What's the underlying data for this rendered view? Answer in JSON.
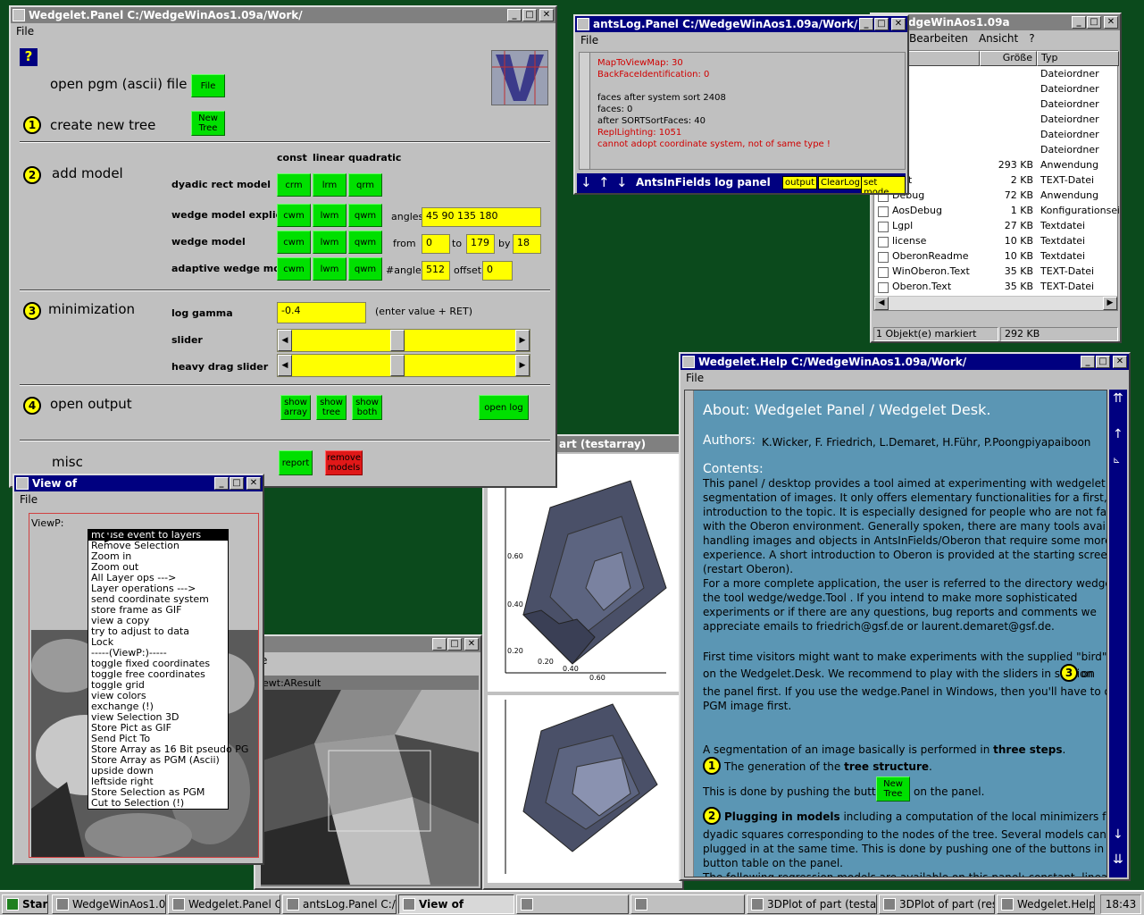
{
  "panel": {
    "title": "Wedgelet.Panel C:/WedgeWinAos1.09a/Work/",
    "menu_file": "File",
    "help_glyph": "?",
    "open_pgm": "open pgm (ascii) file",
    "file_btn": "File",
    "sec1": "create new tree",
    "new_tree_btn": "New\nTree",
    "sec2": "add model",
    "col_const": "const",
    "col_linear": "linear",
    "col_quadratic": "quadratic",
    "row_dyadic": "dyadic rect model",
    "btn_crm": "crm",
    "btn_lrm": "lrm",
    "btn_qrm": "qrm",
    "row_wedge_explicit": "wedge model explicit",
    "row_wedge": "wedge model",
    "row_adaptive": "adaptive wedge model",
    "btn_cwm": "cwm",
    "btn_lwm": "lwm",
    "btn_qwm": "qwm",
    "angles_label": "angles",
    "angles_value": "45 90 135 180",
    "from_label": "from",
    "from_value": "0",
    "to_label": "to",
    "to_value": "179",
    "by_label": "by",
    "by_value": "18",
    "nangles_label": "#angles",
    "nangles_value": "512",
    "offset_label": "offset",
    "offset_value": "0",
    "sec3": "minimization",
    "log_gamma_label": "log gamma",
    "log_gamma_value": "-0.4",
    "enter_hint": "(enter value + RET)",
    "slider_label": "slider",
    "heavy_slider_label": "heavy drag slider",
    "sec4": "open output",
    "show_array": "show\narray",
    "show_tree": "show\ntree",
    "show_both": "show\nboth",
    "open_log": "open log",
    "misc": "misc",
    "report": "report",
    "remove_models": "remove\nmodels",
    "n1": "1",
    "n2": "2",
    "n3": "3",
    "n4": "4"
  },
  "log": {
    "title": "antsLog.Panel C:/WedgeWinAos1.09a/Work/ants...",
    "menu_file": "File",
    "lines": [
      {
        "text": "MapToViewMap:   30",
        "red": true
      },
      {
        "text": "BackFaceIdentification:   0",
        "red": true
      },
      {
        "text": "",
        "red": false
      },
      {
        "text": "faces after system sort       2408",
        "red": false
      },
      {
        "text": "faces:              0",
        "red": false
      },
      {
        "text": "after SORTSortFaces:   40",
        "red": false
      },
      {
        "text": "ReplLighting:     1051",
        "red": true
      },
      {
        "text": "cannot adopt coordinate system, not of same type !",
        "red": true
      }
    ],
    "footer_title": "AntsInFields log panel",
    "btn_output": "output",
    "btn_clearlog": "ClearLog",
    "btn_setmode": "set mode"
  },
  "explorer": {
    "title": "WedgeWinAos1.09a",
    "menu": [
      "Bearbeiten",
      "Ansicht",
      "?"
    ],
    "col_size": "Größe",
    "col_type": "Typ",
    "rows": [
      {
        "name": "",
        "size": "",
        "type": "Dateiordner"
      },
      {
        "name": "et",
        "size": "",
        "type": "Dateiordner"
      },
      {
        "name": "u",
        "size": "",
        "type": "Dateiordner"
      },
      {
        "name": "",
        "size": "",
        "type": "Dateiordner"
      },
      {
        "name": "em",
        "size": "",
        "type": "Dateiordner"
      },
      {
        "name": "",
        "size": "",
        "type": "Dateiordner"
      },
      {
        "name": "",
        "size": "293 KB",
        "type": "Anwendung"
      },
      {
        "name": "Text",
        "size": "2 KB",
        "type": "TEXT-Datei"
      },
      {
        "name": "Debug",
        "size": "72 KB",
        "type": "Anwendung"
      },
      {
        "name": "AosDebug",
        "size": "1 KB",
        "type": "Konfigurationseinst"
      },
      {
        "name": "Lgpl",
        "size": "27 KB",
        "type": "Textdatei"
      },
      {
        "name": "license",
        "size": "10 KB",
        "type": "Textdatei"
      },
      {
        "name": "OberonReadme",
        "size": "10 KB",
        "type": "Textdatei"
      },
      {
        "name": "WinOberon.Text",
        "size": "35 KB",
        "type": "TEXT-Datei"
      },
      {
        "name": "Oberon.Text",
        "size": "35 KB",
        "type": "TEXT-Datei"
      }
    ],
    "status_left": "1 Objekt(e) markiert",
    "status_right": "292 KB"
  },
  "viewof": {
    "title": "View of",
    "menu_file": "File",
    "viewp": "ViewP:",
    "menu_items": [
      "mouse event to layers",
      "Remove Selection",
      "Zoom in",
      "Zoom out",
      "All Layer ops --->",
      "Layer operations --->",
      "send coordinate system",
      "store frame as GIF",
      "view a copy",
      "try to adjust to data",
      "Lock",
      "-----(ViewP:)-----",
      "toggle fixed coordinates",
      "toggle free coordinates",
      "toggle grid",
      "view colors",
      "exchange (!)",
      "view Selection 3D",
      "Store Pict as GIF",
      "Send Pict To",
      "Store Array as 16 Bit pseudo PG",
      "Store Array as PGM (Ascii)",
      "upside down",
      "leftside right",
      "Store Selection as PGM",
      "Cut to Selection (!)"
    ]
  },
  "result": {
    "frag_e": "e",
    "label": "ewt:AResult"
  },
  "plot": {
    "title": "art (testarray)",
    "ticks_y": [
      "0.60",
      "0.40",
      "0.20"
    ],
    "ticks_x": [
      "0.20",
      "0.40",
      "0.60",
      "0.80"
    ]
  },
  "help": {
    "title": "Wedgelet.Help C:/WedgeWinAos1.09a/Work/",
    "menu_file": "File",
    "about": "About: Wedgelet Panel / Wedgelet Desk.",
    "authors_label": "Authors:",
    "authors": "K.Wicker, F. Friedrich, L.Demaret, H.Führ, P.Poongpiyapaiboon",
    "contents": "Contents:",
    "para1": [
      "This panel / desktop provides a tool aimed at experimenting with wedgelet",
      "segmentation of images. It only offers elementary functionalities for a first, rapid",
      "introduction to the topic. It is especially designed for people who are not familiar",
      "with the Oberon environment. Generally spoken, there are many tools available for",
      "handling images and objects in AntsInFields/Oberon that require some more",
      "experience. A short introduction to Oberon is provided at the starting screen",
      "(restart Oberon).",
      "For a more complete application, the user is referred to the directory wedge/ and",
      "the tool wedge/wedge.Tool . If you intend to make more sophisticated",
      "experiments or if there are any questions, bug reports and comments we",
      "appreciate emails to friedrich@gsf.de or laurent.demaret@gsf.de."
    ],
    "para2a": "First time visitors might want to make experiments with the supplied \"bird\" image",
    "para2b": "on the Wedgelet.Desk. We recommend to play with the sliders in section",
    "para2b_num": "3",
    "para2b_end": "on",
    "para2c": "the panel first. If you use the wedge.Panel in Windows, then you'll have to open a",
    "para2d": "PGM image first.",
    "seg_a": "A segmentation of an image basically is performed in ",
    "seg_b": "three steps",
    "seg_c": ".",
    "step1_num": "1",
    "step1_a": "The generation of the ",
    "step1_b": "tree structure",
    "step1_c": ".",
    "step1_line2_a": "This is done by pushing the button",
    "step1_btn": "New\nTree",
    "step1_line2_b": "on the panel.",
    "step2_num": "2",
    "step2_b": "Plugging in models",
    "step2_a": " including a computation of the local minimizers for",
    "step2_lines": [
      "dyadic squares corresponding to the nodes of the tree. Several models can be",
      "plugged in at the same time. This is done by pushing one of the buttons in the",
      "button table on the panel.",
      "The following regression models are available on this panel: constant, linear and"
    ]
  },
  "taskbar": {
    "start": "Start",
    "tasks": [
      "WedgeWinAos1.09a",
      "Wedgelet.Panel C:/...",
      "antsLog.Panel C:/...",
      "View of",
      "",
      "",
      "3DPlot of part (testa...",
      "3DPlot of part (result)",
      "Wedgelet.Help C:/..."
    ],
    "clock": "18:43"
  }
}
